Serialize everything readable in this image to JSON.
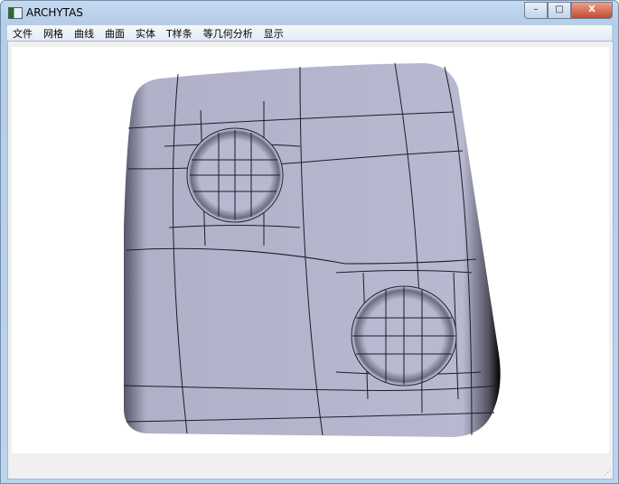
{
  "window": {
    "title": "ARCHYTAS",
    "minimize": "–",
    "maximize": "□",
    "close": "X"
  },
  "menu": [
    {
      "label": "文件"
    },
    {
      "label": "网格"
    },
    {
      "label": "曲线"
    },
    {
      "label": "曲面"
    },
    {
      "label": "实体"
    },
    {
      "label": "T样条"
    },
    {
      "label": "等几何分析"
    },
    {
      "label": "显示"
    }
  ],
  "colors": {
    "surface": "#b8b8d0",
    "edge": "#1c1c2a"
  }
}
